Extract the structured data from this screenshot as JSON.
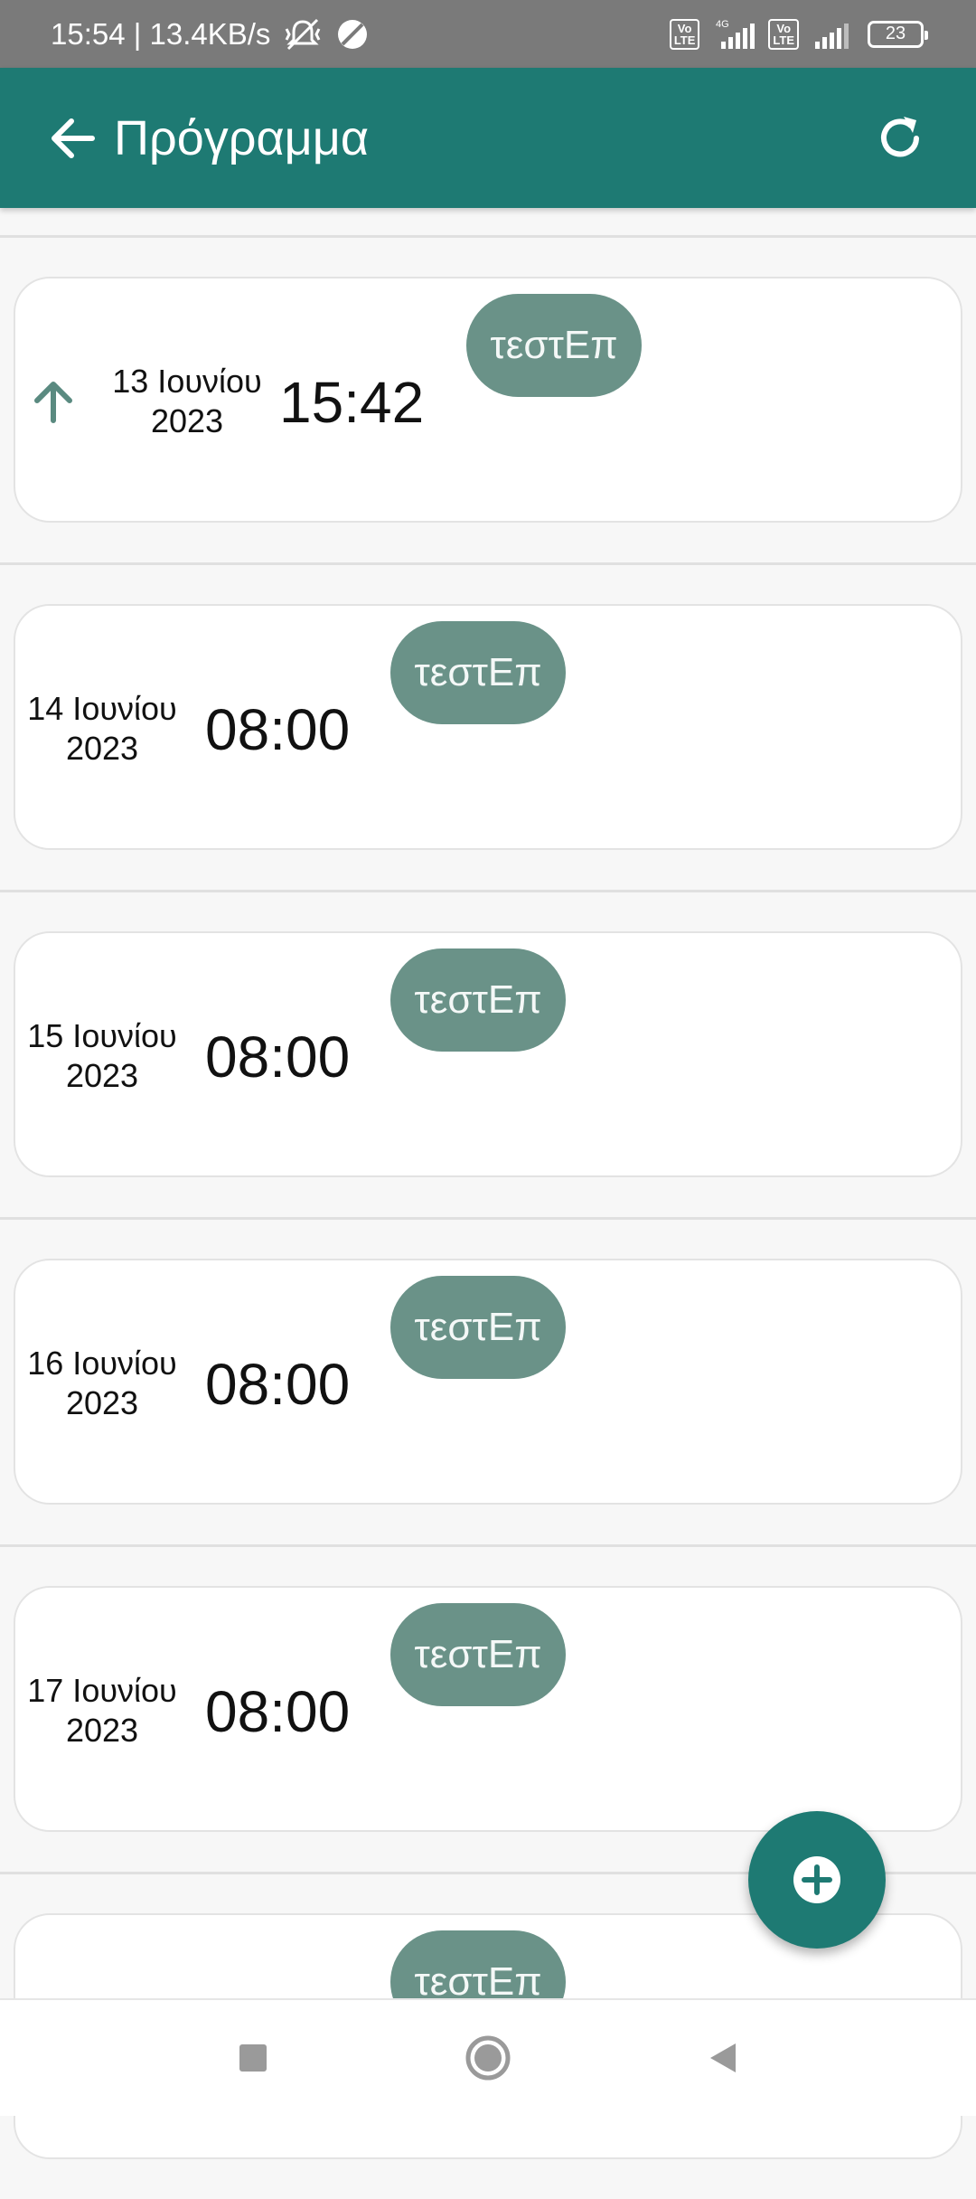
{
  "status_bar": {
    "time_speed": "15:54 | 13.4KB/s",
    "icons": [
      "mute-vibrate-icon",
      "do-not-disturb-icon",
      "volte-icon",
      "signal-4g-icon",
      "volte-icon",
      "signal-icon"
    ],
    "volte_label": "Vo\nLTE",
    "network_label": "4G",
    "battery": "23"
  },
  "app_bar": {
    "title": "Πρόγραμμα",
    "back_icon": "arrow-left-icon",
    "refresh_icon": "refresh-icon"
  },
  "schedule": [
    {
      "day": "13 Ιουνίου",
      "year": "2023",
      "time": "15:42",
      "chip": "τεστΕπ",
      "current": true
    },
    {
      "day": "14 Ιουνίου",
      "year": "2023",
      "time": "08:00",
      "chip": "τεστΕπ",
      "current": false
    },
    {
      "day": "15 Ιουνίου",
      "year": "2023",
      "time": "08:00",
      "chip": "τεστΕπ",
      "current": false
    },
    {
      "day": "16 Ιουνίου",
      "year": "2023",
      "time": "08:00",
      "chip": "τεστΕπ",
      "current": false
    },
    {
      "day": "17 Ιουνίου",
      "year": "2023",
      "time": "08:00",
      "chip": "τεστΕπ",
      "current": false
    },
    {
      "chip": "τεστΕπ"
    }
  ],
  "fab": {
    "icon": "plus-circle-icon"
  },
  "nav_bar": {
    "icons": [
      "recents-square-icon",
      "home-circle-icon",
      "back-triangle-icon"
    ]
  },
  "colors": {
    "primary": "#1e7a73",
    "chip": "#6a9288",
    "status_bar": "#7a7a7a"
  }
}
